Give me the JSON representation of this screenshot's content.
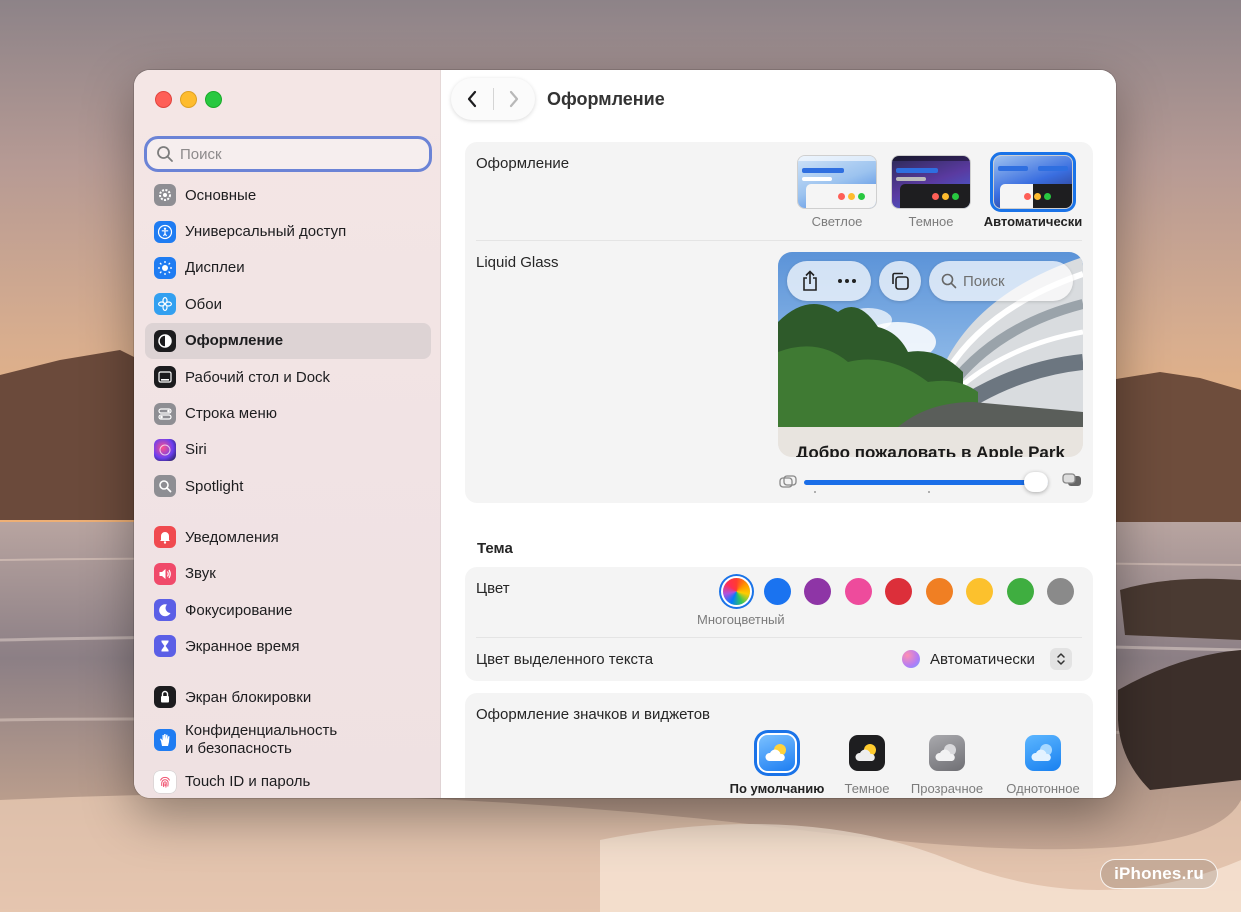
{
  "watermark": "iPhones.ru",
  "window": {
    "sidebar": {
      "search_placeholder": "Поиск",
      "groups": [
        [
          {
            "label": "Основные",
            "icon": "gear-icon",
            "color": "#8e8e93"
          },
          {
            "label": "Универсальный доступ",
            "icon": "accessibility-icon",
            "color": "#1f7cf2"
          },
          {
            "label": "Дисплеи",
            "icon": "sun-icon",
            "color": "#1f7cf2"
          },
          {
            "label": "Обои",
            "icon": "flower-icon",
            "color": "#33a0f0"
          },
          {
            "label": "Оформление",
            "icon": "appearance-icon",
            "color": "#1c1c1e",
            "active": true
          },
          {
            "label": "Рабочий стол и Dock",
            "icon": "dock-icon",
            "color": "#1c1c1e"
          },
          {
            "label": "Строка меню",
            "icon": "menubar-icon",
            "color": "#8e8e93"
          },
          {
            "label": "Siri",
            "icon": "siri-icon",
            "color": "#3a2a7a"
          },
          {
            "label": "Spotlight",
            "icon": "magnifier-icon",
            "color": "#8e8e93"
          }
        ],
        [
          {
            "label": "Уведомления",
            "icon": "bell-icon",
            "color": "#f04a4f"
          },
          {
            "label": "Звук",
            "icon": "speaker-icon",
            "color": "#f04a6a"
          },
          {
            "label": "Фокусирование",
            "icon": "moon-icon",
            "color": "#5b5fe6"
          },
          {
            "label": "Экранное время",
            "icon": "hourglass-icon",
            "color": "#5b5fe6"
          }
        ],
        [
          {
            "label": "Экран блокировки",
            "icon": "lock-icon",
            "color": "#1c1c1e"
          },
          {
            "label": "Конфиденциальность\nи безопасность",
            "icon": "hand-icon",
            "color": "#1f7cf2"
          },
          {
            "label": "Touch ID и пароль",
            "icon": "fingerprint-icon",
            "color": "#ffffff"
          }
        ]
      ]
    },
    "main": {
      "title": "Оформление",
      "appearance": {
        "label": "Оформление",
        "options": [
          {
            "label": "Светлое",
            "selected": false
          },
          {
            "label": "Темное",
            "selected": false
          },
          {
            "label": "Автоматически",
            "selected": true
          }
        ]
      },
      "liquid_glass": {
        "label": "Liquid Glass",
        "preview_search": "Поиск",
        "preview_heading": "Добро пожаловать в Apple Park",
        "slider_value": 0.95
      },
      "theme": {
        "section_title": "Тема",
        "color_label": "Цвет",
        "colors": [
          "multicolor",
          "#1a73f0",
          "#8e35a6",
          "#ee4b9c",
          "#dc2f3a",
          "#f07f23",
          "#fcc12d",
          "#3fae40",
          "#8a8a8a"
        ],
        "selected_color_caption": "Многоцветный",
        "highlight_label": "Цвет выделенного текста",
        "highlight_value": "Автоматически"
      },
      "icons": {
        "label": "Оформление значков и виджетов",
        "options": [
          {
            "label": "По умолчанию",
            "selected": true
          },
          {
            "label": "Темное",
            "selected": false
          },
          {
            "label": "Прозрачное",
            "selected": false
          },
          {
            "label": "Однотонное",
            "selected": false
          }
        ]
      }
    }
  }
}
